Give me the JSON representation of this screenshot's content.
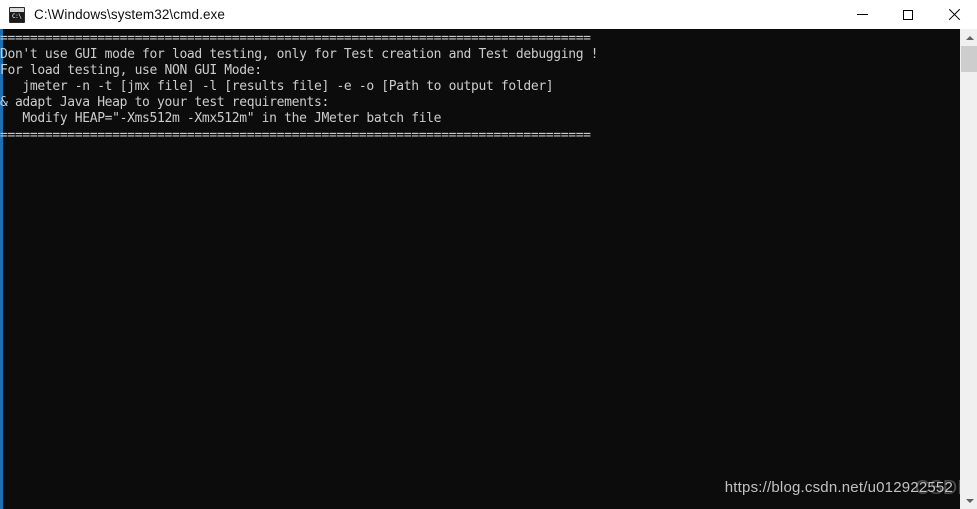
{
  "window": {
    "title": "C:\\Windows\\system32\\cmd.exe",
    "icon": "cmd-console-icon",
    "icon_prompt": "C:\\",
    "accent_color": "#1a6fb5",
    "background_color": "#0c0c0c",
    "text_color": "#cccccc",
    "titlebar_background": "#ffffff"
  },
  "controls": {
    "minimize_label": "Minimize",
    "maximize_label": "Maximize",
    "close_label": "Close"
  },
  "console": {
    "lines": [
      "===============================================================================",
      "Don't use GUI mode for load testing, only for Test creation and Test debugging !",
      "For load testing, use NON GUI Mode:",
      "   jmeter -n -t [jmx file] -l [results file] -e -o [Path to output folder]",
      "& adapt Java Heap to your test requirements:",
      "   Modify HEAP=\"-Xms512m -Xmx512m\" in the JMeter batch file",
      "==============================================================================="
    ],
    "text": "===============================================================================\nDon't use GUI mode for load testing, only for Test creation and Test debugging !\nFor load testing, use NON GUI Mode:\n   jmeter -n -t [jmx file] -l [results file] -e -o [Path to output folder]\n& adapt Java Heap to your test requirements:\n   Modify HEAP=\"-Xms512m -Xmx512m\" in the JMeter batch file\n==============================================================================="
  },
  "watermark": {
    "url": "https://blog.csdn.net/u012922552",
    "logo_text": "CSDN"
  },
  "scrollbar": {
    "up_arrow": "chevron-up-icon",
    "down_arrow": "chevron-down-icon",
    "thumb_position": "top"
  }
}
